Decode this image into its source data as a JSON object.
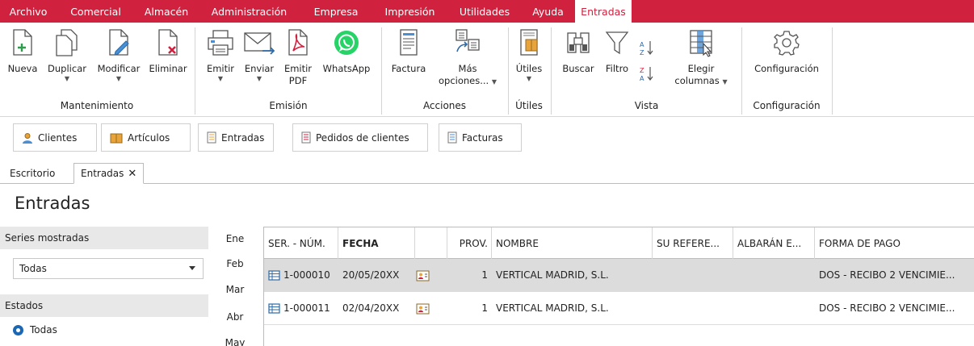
{
  "menu": {
    "items": [
      "Archivo",
      "Comercial",
      "Almacén",
      "Administración",
      "Empresa",
      "Impresión",
      "Utilidades",
      "Ayuda",
      "Entradas"
    ],
    "active": "Entradas"
  },
  "ribbon": {
    "mantenimiento": {
      "label": "Mantenimiento",
      "nueva": "Nueva",
      "duplicar": "Duplicar",
      "modificar": "Modificar",
      "eliminar": "Eliminar"
    },
    "emision": {
      "label": "Emisión",
      "emitir": "Emitir",
      "enviar": "Enviar",
      "emitir_pdf_1": "Emitir",
      "emitir_pdf_2": "PDF",
      "whatsapp": "WhatsApp"
    },
    "acciones": {
      "label": "Acciones",
      "factura": "Factura",
      "mas_1": "Más",
      "mas_2": "opciones..."
    },
    "utiles": {
      "label": "Útiles",
      "utiles": "Útiles"
    },
    "vista": {
      "label": "Vista",
      "buscar": "Buscar",
      "filtro": "Filtro",
      "elegir_1": "Elegir",
      "elegir_2": "columnas"
    },
    "configuracion": {
      "label": "Configuración",
      "configuracion": "Configuración"
    }
  },
  "quick": {
    "clientes": "Clientes",
    "articulos": "Artículos",
    "entradas": "Entradas",
    "pedidos": "Pedidos de clientes",
    "facturas": "Facturas"
  },
  "tabs": {
    "escritorio": "Escritorio",
    "entradas": "Entradas"
  },
  "page_title": "Entradas",
  "filters": {
    "series_label": "Series mostradas",
    "series_value": "Todas",
    "estados_label": "Estados",
    "estados_value": "Todas"
  },
  "months": [
    "Ene",
    "Feb",
    "Mar",
    "Abr",
    "May"
  ],
  "table": {
    "columns": [
      "SER. - NÚM.",
      "FECHA",
      "",
      "PROV.",
      "NOMBRE",
      "SU REFERE...",
      "ALBARÁN E...",
      "FORMA DE PAGO"
    ],
    "rows": [
      {
        "num": "1-000010",
        "fecha": "20/05/20XX",
        "prov": "1",
        "nombre": "VERTICAL MADRID, S.L.",
        "ref": "",
        "albaran": "",
        "pago": "DOS - RECIBO 2 VENCIMIE..."
      },
      {
        "num": "1-000011",
        "fecha": "02/04/20XX",
        "prov": "1",
        "nombre": "VERTICAL MADRID, S.L.",
        "ref": "",
        "albaran": "",
        "pago": "DOS - RECIBO 2 VENCIMIE..."
      }
    ]
  },
  "colors": {
    "accent": "#d0213f",
    "selected_row": "#dcdcdc",
    "radio": "#1a67b5"
  }
}
